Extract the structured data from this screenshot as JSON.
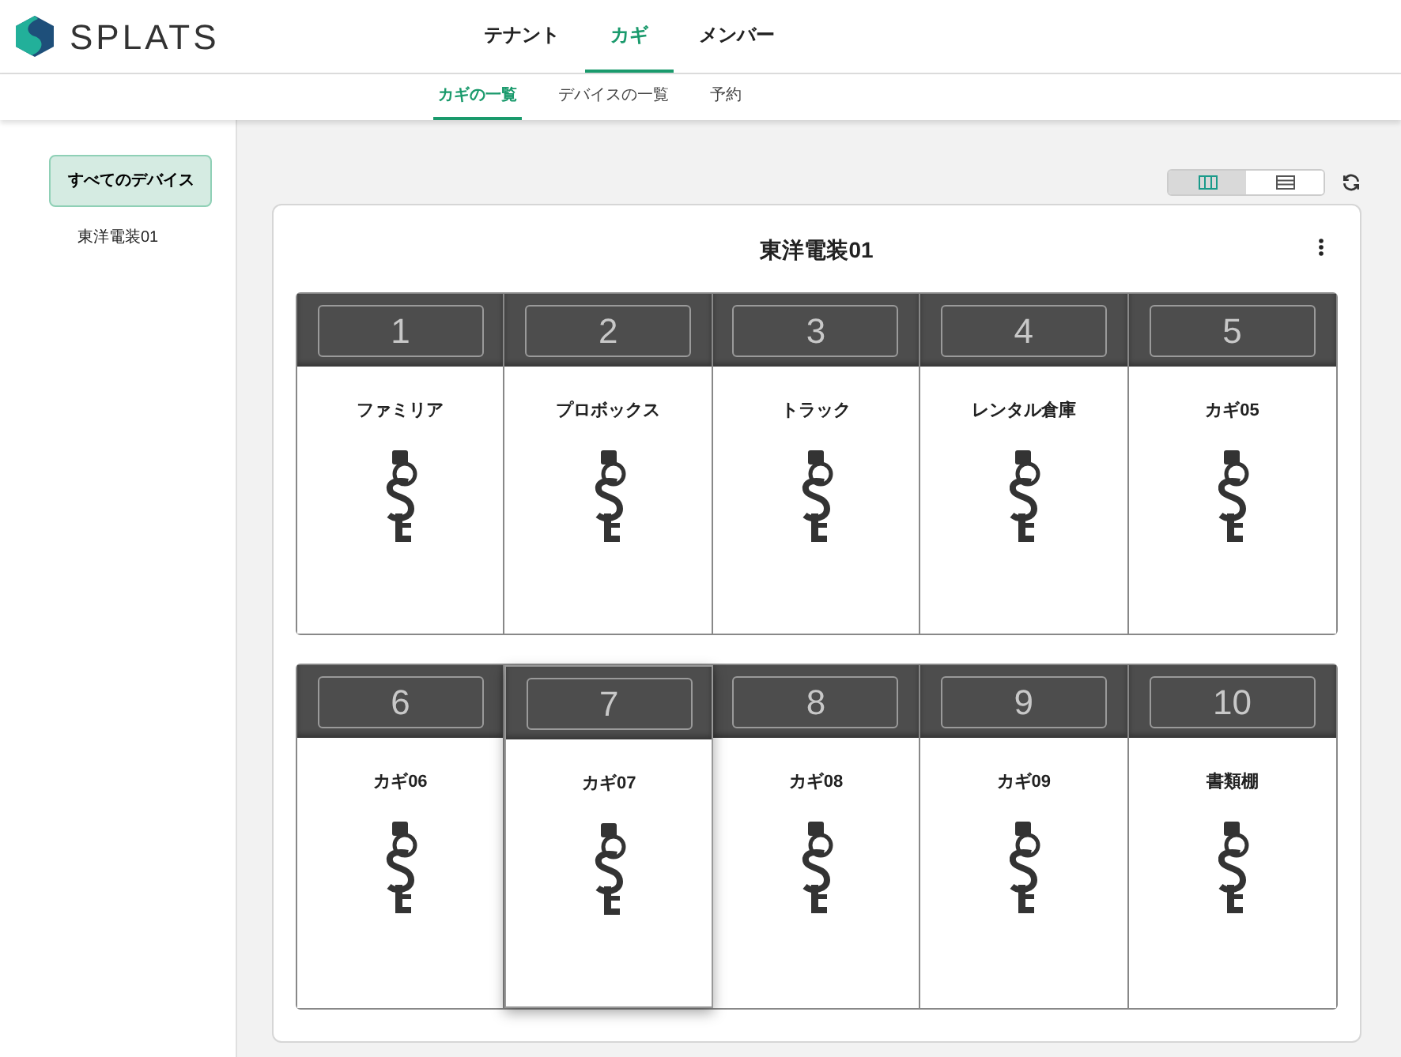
{
  "brand": {
    "name": "SPLATS"
  },
  "nav": [
    {
      "label": "テナント",
      "selected": false
    },
    {
      "label": "カギ",
      "selected": true
    },
    {
      "label": "メンバー",
      "selected": false
    }
  ],
  "subnav": [
    {
      "label": "カギの一覧",
      "selected": true
    },
    {
      "label": "デバイスの一覧",
      "selected": false
    },
    {
      "label": "予約",
      "selected": false
    }
  ],
  "sidebar": {
    "items": [
      {
        "label": "すべてのデバイス",
        "selected": true
      },
      {
        "label": "東洋電装01",
        "selected": false
      }
    ]
  },
  "view_toggle": [
    {
      "kind": "columns",
      "selected": true
    },
    {
      "kind": "list",
      "selected": false
    }
  ],
  "device": {
    "title": "東洋電装01",
    "rows": [
      [
        {
          "number": "1",
          "name": "ファミリア",
          "highlighted": false
        },
        {
          "number": "2",
          "name": "プロボックス",
          "highlighted": false
        },
        {
          "number": "3",
          "name": "トラック",
          "highlighted": false
        },
        {
          "number": "4",
          "name": "レンタル倉庫",
          "highlighted": false
        },
        {
          "number": "5",
          "name": "カギ05",
          "highlighted": false
        }
      ],
      [
        {
          "number": "6",
          "name": "カギ06",
          "highlighted": false
        },
        {
          "number": "7",
          "name": "カギ07",
          "highlighted": true
        },
        {
          "number": "8",
          "name": "カギ08",
          "highlighted": false
        },
        {
          "number": "9",
          "name": "カギ09",
          "highlighted": false
        },
        {
          "number": "10",
          "name": "書類棚",
          "highlighted": false
        }
      ]
    ]
  }
}
